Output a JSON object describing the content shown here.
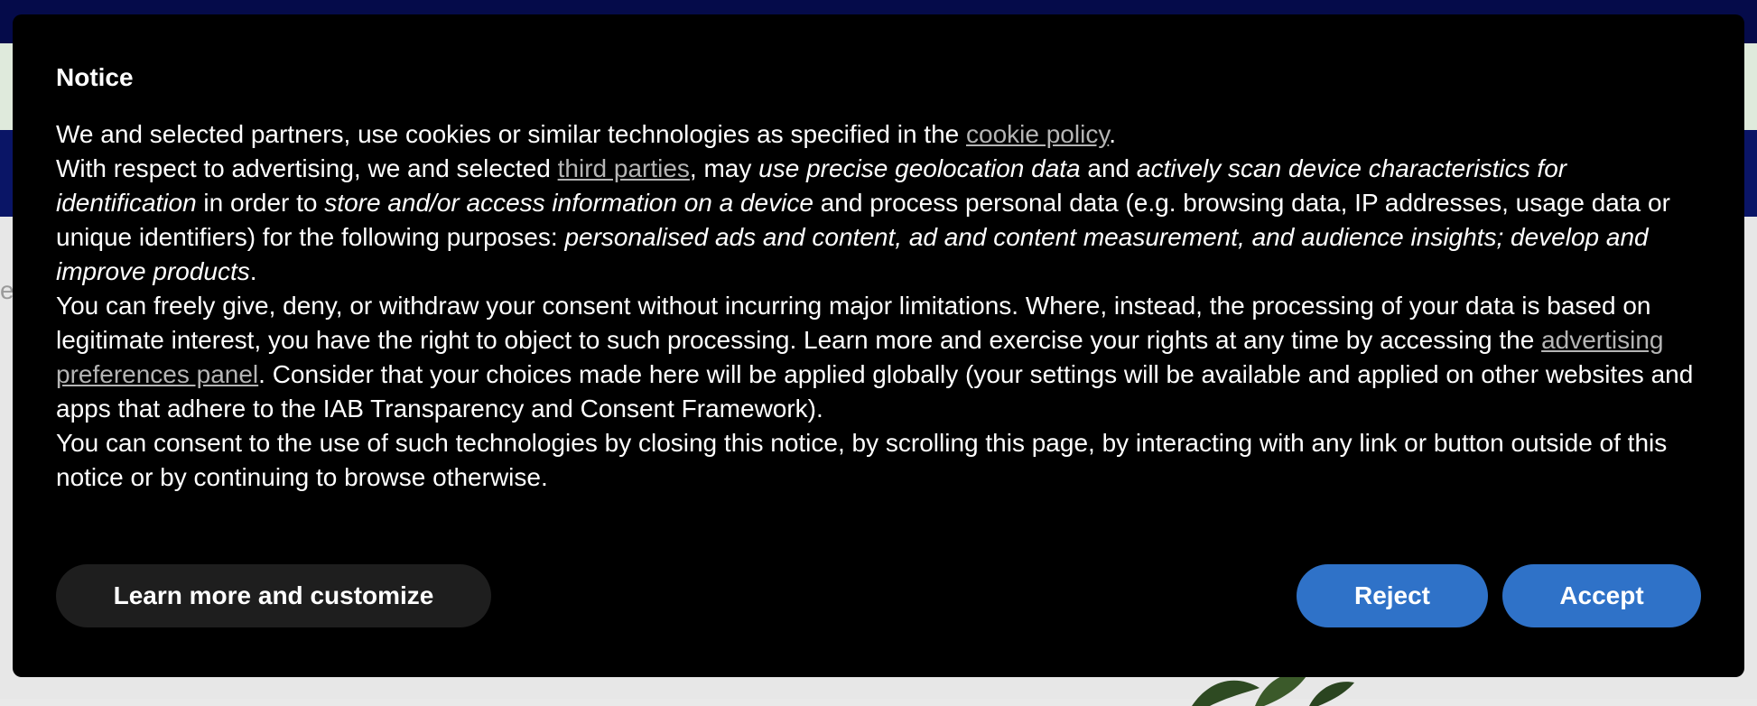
{
  "background": {
    "edge_text": "es"
  },
  "notice": {
    "title": "Notice",
    "p1": {
      "before": "We and selected partners, use cookies or similar technologies as specified in the ",
      "link": "cookie policy",
      "after": "."
    },
    "p2": {
      "t1": "With respect to advertising, we and selected ",
      "link": "third parties",
      "t2": ", may ",
      "i1": "use precise geolocation data",
      "t3": " and ",
      "i2": "actively scan device characteristics for identification",
      "t4": " in order to ",
      "i3": "store and/or access information on a device",
      "t5": " and process personal data (e.g. browsing data, IP addresses, usage data or unique identifiers) for the following purposes: ",
      "i4": "personalised ads and content, ad and content measurement, and audience insights; develop and improve products",
      "t6": "."
    },
    "p3": {
      "t1": "You can freely give, deny, or withdraw your consent without incurring major limitations. Where, instead, the processing of your data is based on legitimate interest, you have the right to object to such processing. Learn more and exercise your rights at any time by accessing the ",
      "link": "advertising preferences panel",
      "t2": ". Consider that your choices made here will be applied globally (your settings will be available and applied on other websites and apps that adhere to the IAB Transparency and Consent Framework)."
    },
    "p4": "You can consent to the use of such technologies by closing this notice, by scrolling this page, by interacting with any link or button outside of this notice or by continuing to browse otherwise.",
    "buttons": {
      "learn_more": "Learn more and customize",
      "reject": "Reject",
      "accept": "Accept"
    }
  },
  "colors": {
    "modal_bg": "#000000",
    "button_primary": "#2f72c8",
    "button_secondary": "#1e1e1e",
    "link": "#b5b5b5"
  }
}
